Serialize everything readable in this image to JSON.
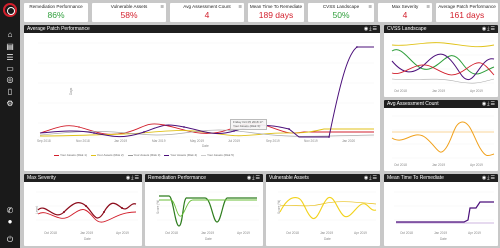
{
  "kpis": [
    {
      "label": "Remediation Performance",
      "value": "86%",
      "color": "#2e9e3a"
    },
    {
      "label": "Vulnerable Assets",
      "value": "58%",
      "color": "#d21f2c"
    },
    {
      "label": "Avg Assessment Count",
      "value": "4",
      "color": "#d21f2c"
    },
    {
      "label": "Mean Time To Remediate",
      "value": "189 days",
      "color": "#d21f2c"
    },
    {
      "label": "CVSS Landscape",
      "value": "50%",
      "color": "#2e9e3a"
    },
    {
      "label": "Max Severity",
      "value": "4",
      "color": "#d21f2c"
    },
    {
      "label": "Average Patch Performance",
      "value": "161 days",
      "color": "#d21f2c"
    }
  ],
  "panels": {
    "avg_patch": {
      "title": "Average Patch Performance"
    },
    "cvss": {
      "title": "CVSS Landscape"
    },
    "avg_assessment": {
      "title": "Avg Assessment Count"
    },
    "max_severity": {
      "title": "Max Severity"
    },
    "remediation": {
      "title": "Remediation Performance"
    },
    "vulnerable": {
      "title": "Vulnerable Assets"
    },
    "mttr": {
      "title": "Mean Time To Remediate"
    }
  },
  "tooltip": {
    "line1": "Friday Oct 05 2018 17:",
    "line2": "Your Assets (Risk 3): "
  },
  "legend": [
    "Your Assets (Risk 1)",
    "Your Assets (Risk 2)",
    "Your Assets (Risk 3)",
    "Your Assets (Risk 4)",
    "Your Assets (Risk 5)"
  ],
  "legend_colors": [
    "#d21f2c",
    "#e0c21a",
    "#999999",
    "#4b0f7a",
    "#cccccc"
  ],
  "axis": {
    "date": "Date",
    "days": "Days",
    "level": "Level",
    "score": "Score (%)"
  },
  "ticks": {
    "main_x": [
      "Sep 2018",
      "Nov 2018",
      "Jan 2019",
      "Mar 2019",
      "May 2019",
      "Jul 2019",
      "Sep 2019",
      "Nov 2019",
      "Jan 2020"
    ],
    "small_x": [
      "Oct 2018",
      "Jan 2019",
      "Apr 2019"
    ]
  },
  "icons": {
    "toolbar": [
      "eye-icon",
      "download-icon",
      "menu-icon"
    ]
  }
}
